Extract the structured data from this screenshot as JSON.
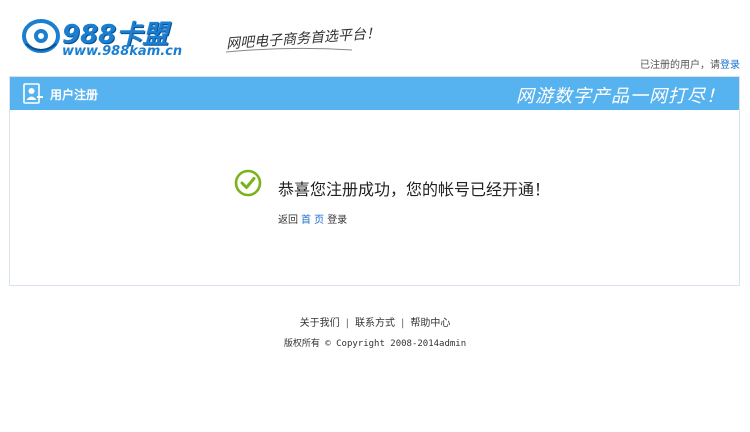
{
  "header": {
    "logo_title": "988卡盟",
    "logo_url": "www.988kam.cn",
    "slogan": "网吧电子商务首选平台！",
    "login_hint_prefix": "已注册的用户，请",
    "login_link": "登录"
  },
  "panel": {
    "title": "用户注册",
    "motto": "网游数字产品一网打尽！",
    "success_message": "恭喜您注册成功，您的帐号已经开通！",
    "return_prefix": "返回",
    "home_link": "首 页",
    "login_link": "登录"
  },
  "footer": {
    "links": [
      "关于我们",
      "联系方式",
      "帮助中心"
    ],
    "copyright_cn": "版权所有",
    "copyright_en": "© Copyright 2008-2014admin"
  },
  "colors": {
    "header_bar": "#57b2f0",
    "link": "#1a6fcf",
    "success": "#7ab317",
    "logo": "#1b7fd1"
  },
  "icons": {
    "logo": "eye-logo-icon",
    "panel": "user-register-icon",
    "success": "check-circle-icon"
  }
}
